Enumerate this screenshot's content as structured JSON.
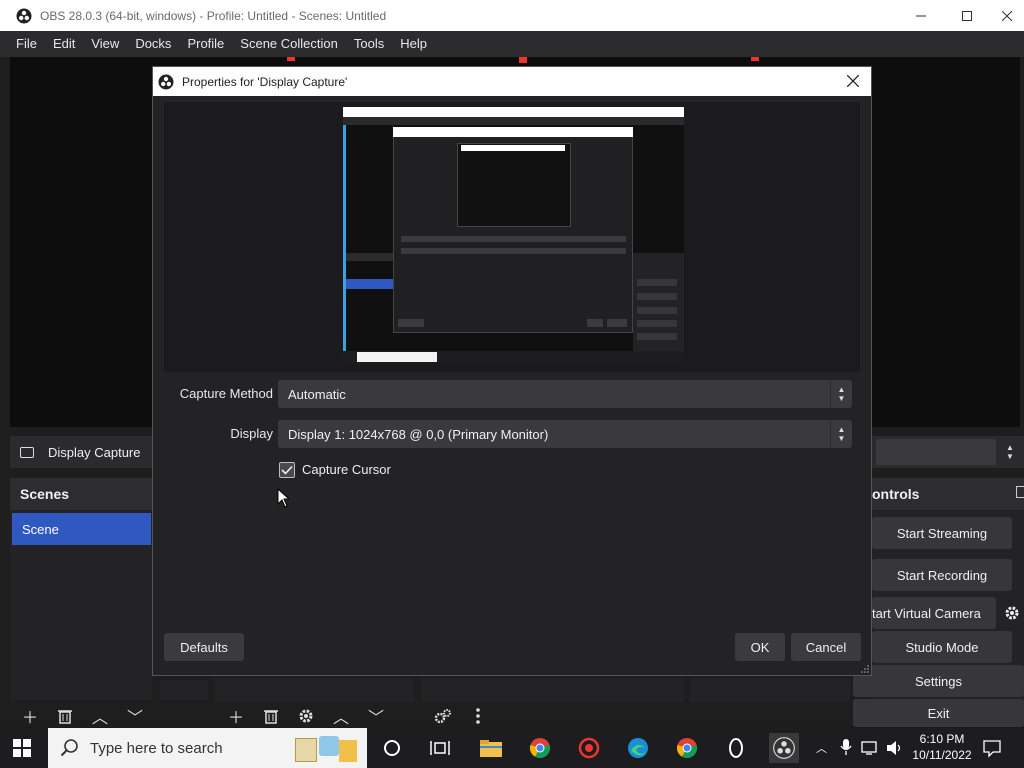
{
  "window": {
    "title": "OBS 28.0.3 (64-bit, windows) - Profile: Untitled - Scenes: Untitled"
  },
  "menu": [
    "File",
    "Edit",
    "View",
    "Docks",
    "Profile",
    "Scene Collection",
    "Tools",
    "Help"
  ],
  "source": {
    "label": "Display Capture"
  },
  "scenes": {
    "header": "Scenes",
    "items": [
      "Scene"
    ]
  },
  "controls": {
    "header": "Controls",
    "header_visible": "ontrols",
    "buttons": {
      "start_streaming": "Start Streaming",
      "start_recording": "Start Recording",
      "start_virtual_camera": "Start Virtual Camera",
      "virtual_camera_visible": "tart Virtual Camera",
      "studio_mode": "Studio Mode",
      "settings": "Settings",
      "exit": "Exit"
    }
  },
  "dialog": {
    "title": "Properties for 'Display Capture'",
    "capture_method": {
      "label": "Capture Method",
      "value": "Automatic"
    },
    "display": {
      "label": "Display",
      "value": "Display 1: 1024x768 @ 0,0 (Primary Monitor)"
    },
    "capture_cursor": {
      "label": "Capture Cursor",
      "checked": true
    },
    "buttons": {
      "defaults": "Defaults",
      "ok": "OK",
      "cancel": "Cancel"
    }
  },
  "taskbar": {
    "search_placeholder": "Type here to search",
    "time": "6:10 PM",
    "date": "10/11/2022"
  },
  "colors": {
    "accent": "#2f59c0",
    "bg": "#1e1e1e",
    "panel": "#2d2d30"
  }
}
